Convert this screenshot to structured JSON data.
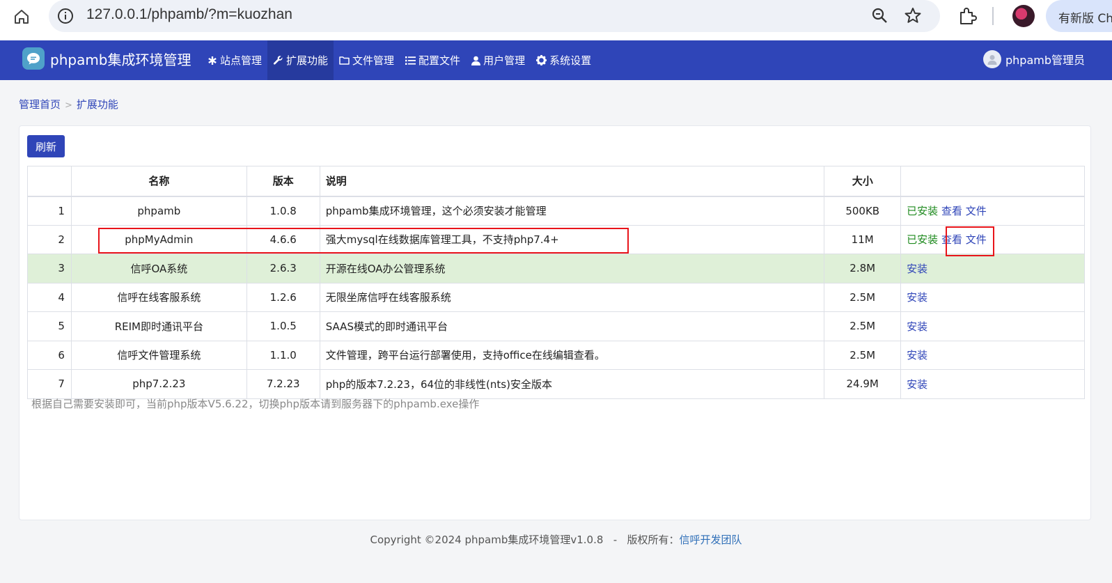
{
  "browser": {
    "url": "127.0.0.1/phpamb/?m=kuozhan",
    "update_label": "有新版 Ch"
  },
  "navbar": {
    "brand": "phpamb集成环境管理",
    "items": [
      {
        "label": "站点管理",
        "icon": "asterisk-icon"
      },
      {
        "label": "扩展功能",
        "icon": "wrench-icon",
        "active": true
      },
      {
        "label": "文件管理",
        "icon": "folder-icon"
      },
      {
        "label": "配置文件",
        "icon": "list-icon"
      },
      {
        "label": "用户管理",
        "icon": "user-icon"
      },
      {
        "label": "系统设置",
        "icon": "gear-icon"
      }
    ],
    "user": "phpamb管理员"
  },
  "breadcrumb": {
    "home": "管理首页",
    "separator": ">",
    "current": "扩展功能"
  },
  "toolbar": {
    "refresh_label": "刷新"
  },
  "table": {
    "headers": [
      "",
      "名称",
      "版本",
      "说明",
      "大小",
      ""
    ],
    "rows": [
      {
        "no": "1",
        "name": "phpamb",
        "version": "1.0.8",
        "desc": "phpamb集成环境管理，这个必须安装才能管理",
        "size": "500KB",
        "status": "已安装",
        "view": "查看",
        "file": "文件"
      },
      {
        "no": "2",
        "name": "phpMyAdmin",
        "version": "4.6.6",
        "desc": "强大mysql在线数据库管理工具，不支持php7.4+",
        "size": "11M",
        "status": "已安装",
        "view": "查看",
        "file": "文件"
      },
      {
        "no": "3",
        "name": "信呼OA系统",
        "version": "2.6.3",
        "desc": "开源在线OA办公管理系统",
        "size": "2.8M",
        "install": "安装"
      },
      {
        "no": "4",
        "name": "信呼在线客服系统",
        "version": "1.2.6",
        "desc": "无限坐席信呼在线客服系统",
        "size": "2.5M",
        "install": "安装"
      },
      {
        "no": "5",
        "name": "REIM即时通讯平台",
        "version": "1.0.5",
        "desc": "SAAS模式的即时通讯平台",
        "size": "2.5M",
        "install": "安装"
      },
      {
        "no": "6",
        "name": "信呼文件管理系统",
        "version": "1.1.0",
        "desc": "文件管理，跨平台运行部署使用，支持office在线编辑查看。",
        "size": "2.5M",
        "install": "安装"
      },
      {
        "no": "7",
        "name": "php7.2.23",
        "version": "7.2.23",
        "desc": "php的版本7.2.23，64位的非线性(nts)安全版本",
        "size": "24.9M",
        "install": "安装"
      }
    ]
  },
  "note": "根据自己需要安装即可，当前php版本V5.6.22，切换php版本请到服务器下的phpamb.exe操作",
  "footer": {
    "copyright": "Copyright ©2024 phpamb集成环境管理v1.0.8",
    "dash": "-",
    "rights_label": "版权所有：",
    "team": "信呼开发团队"
  },
  "colors": {
    "navbar": "#2f45b8",
    "installed": "#1e8a1e",
    "highlight_row": "#dff0d8",
    "annotation": "#e8141a"
  }
}
